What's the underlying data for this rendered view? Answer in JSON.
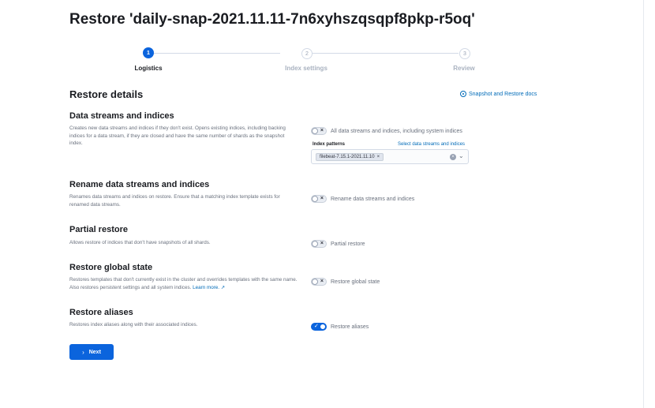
{
  "page": {
    "title": "Restore 'daily-snap-2021.11.11-7n6xyhszqsqpf8pkp-r5oq'"
  },
  "steps": [
    {
      "number": "1",
      "label": "Logistics",
      "state": "active"
    },
    {
      "number": "2",
      "label": "Index settings",
      "state": "inactive"
    },
    {
      "number": "3",
      "label": "Review",
      "state": "inactive"
    }
  ],
  "section": {
    "heading": "Restore details",
    "docs_link": "Snapshot and Restore docs",
    "docs_icon": "book-icon"
  },
  "data_streams": {
    "title": "Data streams and indices",
    "description": "Creates new data streams and indices if they don't exist. Opens existing indices, including backing indices for a data stream, if they are closed and have the same number of shards as the snapshot index.",
    "switch_label": "All data streams and indices, including system indices",
    "switch_on": false,
    "patterns_label": "Index patterns",
    "patterns_link": "Select data streams and indices",
    "selected_pattern": "filebeat-7.15.1-2021.11.10"
  },
  "rename": {
    "title": "Rename data streams and indices",
    "description": "Renames data streams and indices on restore. Ensure that a matching index template exists for renamed data streams.",
    "switch_label": "Rename data streams and indices",
    "switch_on": false
  },
  "partial": {
    "title": "Partial restore",
    "description": "Allows restore of indices that don't have snapshots of all shards.",
    "switch_label": "Partial restore",
    "switch_on": false
  },
  "global_state": {
    "title": "Restore global state",
    "description": "Restores templates that don't currently exist in the cluster and overrides templates with the same name. Also restores persistent settings and all system indices.",
    "learn_more": "Learn more.",
    "switch_label": "Restore global state",
    "switch_on": false
  },
  "aliases": {
    "title": "Restore aliases",
    "description": "Restores index aliases along with their associated indices.",
    "switch_label": "Restore aliases",
    "switch_on": true
  },
  "footer": {
    "next_label": "Next"
  },
  "colors": {
    "primary": "#0b64dd",
    "link": "#006bb8",
    "text": "#343741",
    "muted": "#69707d"
  }
}
